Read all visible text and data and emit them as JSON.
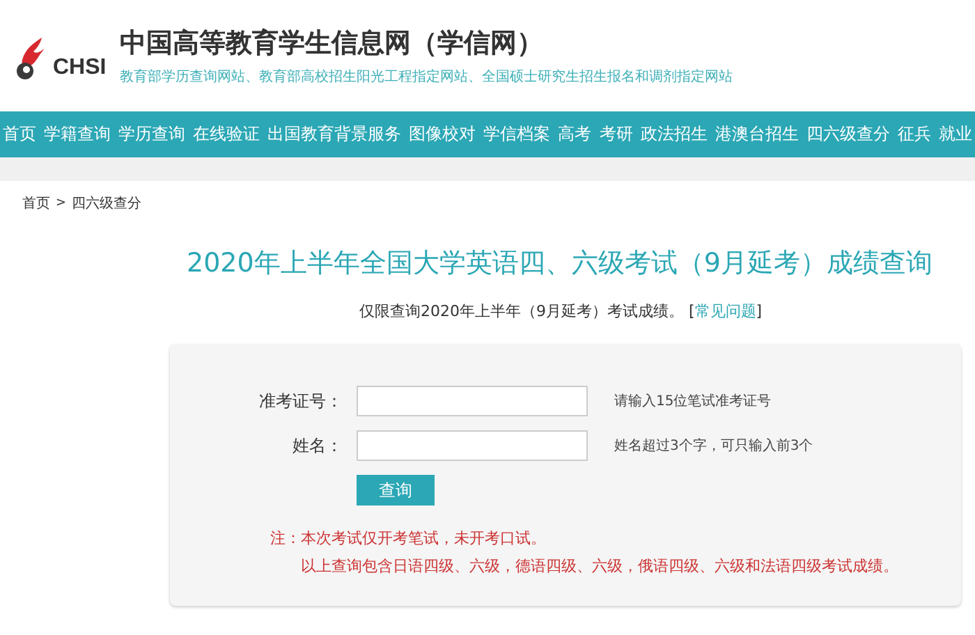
{
  "header": {
    "logo_text": "CHSI",
    "site_title": "中国高等教育学生信息网（学信网）",
    "tagline": "教育部学历查询网站、教育部高校招生阳光工程指定网站、全国硕士研究生招生报名和调剂指定网站"
  },
  "nav": [
    {
      "label": "首页"
    },
    {
      "label": "学籍查询"
    },
    {
      "label": "学历查询"
    },
    {
      "label": "在线验证"
    },
    {
      "label": "出国教育背景服务"
    },
    {
      "label": "图像校对"
    },
    {
      "label": "学信档案"
    },
    {
      "label": "高考"
    },
    {
      "label": "考研"
    },
    {
      "label": "政法招生"
    },
    {
      "label": "港澳台招生"
    },
    {
      "label": "四六级查分"
    },
    {
      "label": "征兵"
    },
    {
      "label": "就业"
    }
  ],
  "breadcrumb": {
    "items": [
      "首页",
      "四六级查分"
    ],
    "separator": ">"
  },
  "page_title": "2020年上半年全国大学英语四、六级考试（9月延考）成绩查询",
  "notice": {
    "text": "仅限查询2020年上半年（9月延考）考试成绩。",
    "link_open": "[",
    "link": "常见问题",
    "link_close": "]"
  },
  "form": {
    "fields": [
      {
        "label": "准考证号：",
        "hint": "请输入15位笔试准考证号"
      },
      {
        "label": "姓名：",
        "hint": "姓名超过3个字，可只输入前3个"
      }
    ],
    "submit": "查询",
    "note_label": "注：",
    "notes": [
      "本次考试仅开考笔试，未开考口试。",
      "以上查询包含日语四级、六级，德语四级、六级，俄语四级、六级和法语四级考试成绩。"
    ]
  }
}
